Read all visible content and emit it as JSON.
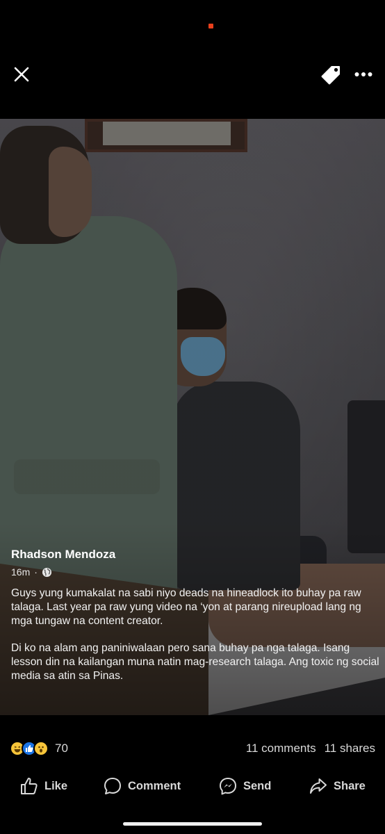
{
  "post": {
    "author": "Rhadson Mendoza",
    "time": "16m",
    "separator": "·",
    "paragraphs": [
      "Guys yung kumakalat na sabi niyo deads na hineadlock ito buhay pa raw talaga. Last year pa raw yung video na ‘yon at parang nireupload lang ng mga tungaw na content creator.",
      "Di ko na alam ang paniniwalaan pero sana buhay pa nga talaga. Isang lesson din na kailangan muna natin mag-research talaga. Ang toxic ng social media sa atin sa Pinas."
    ]
  },
  "stats": {
    "reactions": [
      "haha",
      "like",
      "wow"
    ],
    "reaction_count": "70",
    "comments": "11 comments",
    "shares": "11 shares"
  },
  "actions": {
    "like": "Like",
    "comment": "Comment",
    "send": "Send",
    "share": "Share"
  },
  "icons": {
    "close": "close-icon",
    "tag": "tag-icon",
    "more": "more-icon",
    "audience": "globe-icon"
  },
  "colors": {
    "background": "#000000",
    "like_blue": "#1b74e4",
    "reaction_yellow": "#f7c53a",
    "recording_dot": "#e8401c"
  }
}
